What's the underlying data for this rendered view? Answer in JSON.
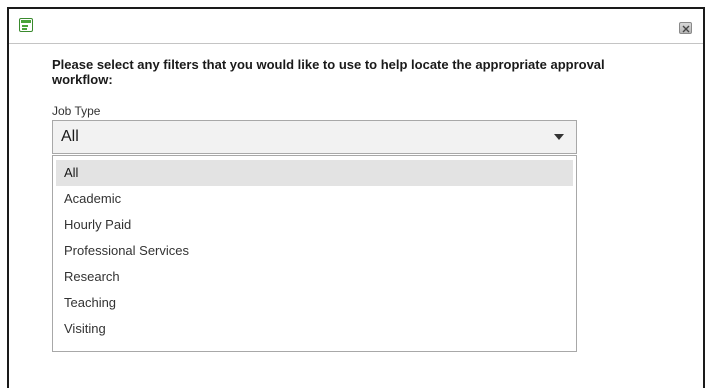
{
  "dialog": {
    "app_icon": "form-icon",
    "close_icon": "close-icon",
    "prompt": "Please select any filters that you would like to use to help locate the appropriate approval workflow:"
  },
  "job_type": {
    "label": "Job Type",
    "selected": "All",
    "arrow_icon": "caret-down-icon",
    "options": [
      "All",
      "Academic",
      "Hourly Paid",
      "Professional Services",
      "Research",
      "Teaching",
      "Visiting"
    ],
    "highlighted_index": 0
  }
}
